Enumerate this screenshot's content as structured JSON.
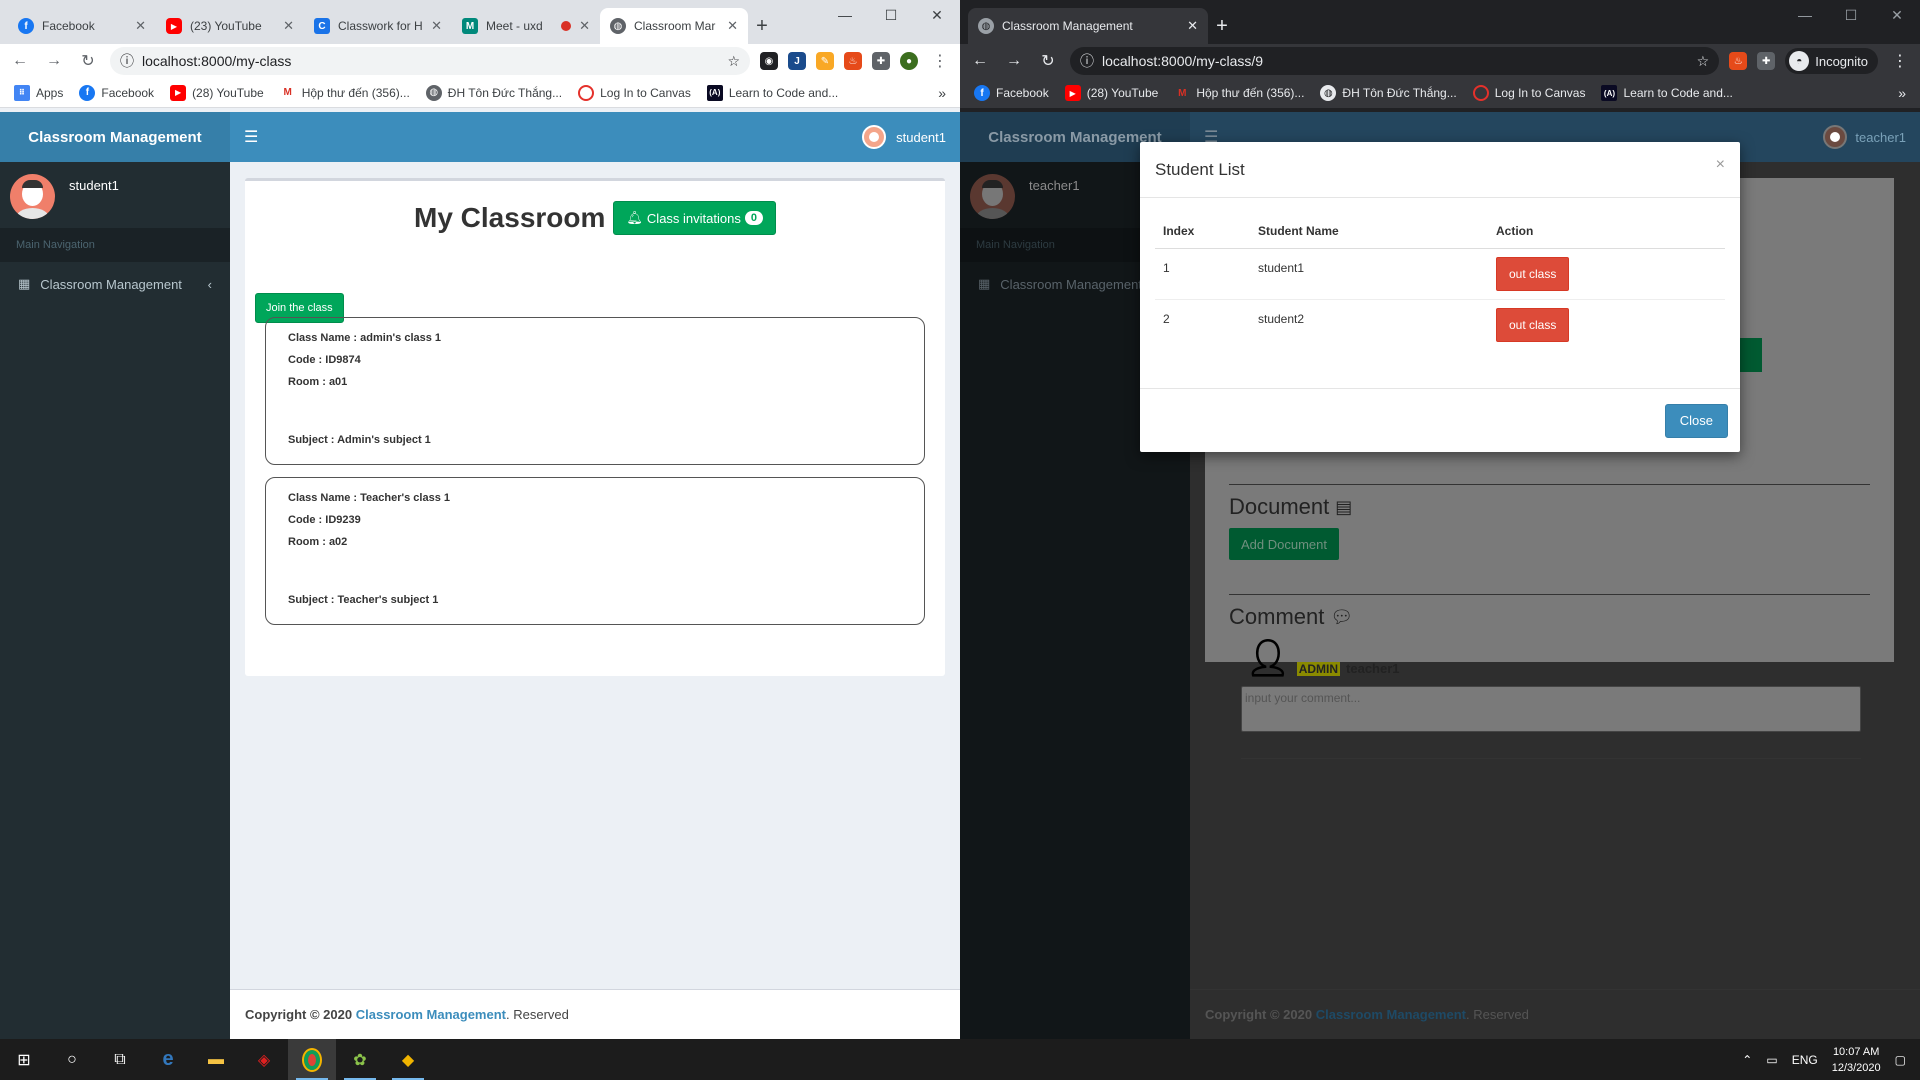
{
  "left_browser": {
    "tabs": [
      {
        "title": "Facebook",
        "icon": "facebook-icon",
        "color": "#1877f2",
        "glyph": "f"
      },
      {
        "title": "(23) YouTube",
        "icon": "youtube-icon",
        "color": "#ff0000",
        "glyph": "▶"
      },
      {
        "title": "Classwork for H",
        "icon": "classroom-icon",
        "color": "#1a73e8",
        "glyph": "C"
      },
      {
        "title": "Meet - uxd",
        "icon": "meet-icon",
        "color": "#00897b",
        "glyph": "M"
      },
      {
        "title": "Classroom Mar",
        "icon": "globe-icon",
        "color": "#5f6368",
        "glyph": "◍",
        "active": true
      }
    ],
    "url": "localhost:8000/my-class",
    "bookmarks": [
      {
        "label": "Apps",
        "icon": "apps-grid-icon"
      },
      {
        "label": "Facebook",
        "icon": "facebook-icon"
      },
      {
        "label": "(28) YouTube",
        "icon": "youtube-icon"
      },
      {
        "label": "Hộp thư đến (356)...",
        "icon": "gmail-icon"
      },
      {
        "label": "ĐH Tôn Đức Thắng...",
        "icon": "university-icon"
      },
      {
        "label": "Log In to Canvas",
        "icon": "canvas-icon"
      },
      {
        "label": "Learn to Code and...",
        "icon": "freecodecamp-icon"
      }
    ]
  },
  "left_app": {
    "brand": "Classroom Management",
    "username": "student1",
    "nav_header": "Main Navigation",
    "nav_item": "Classroom Management",
    "page_title": "My Classroom",
    "invitations_label": "Class invitations",
    "invitations_count": "0",
    "join_label": "Join the class",
    "classes": [
      {
        "name": "Class Name : admin's class 1",
        "code": "Code : ID9874",
        "room": "Room : a01",
        "subject": "Subject : Admin's subject 1"
      },
      {
        "name": "Class Name : Teacher's class 1",
        "code": "Code : ID9239",
        "room": "Room : a02",
        "subject": "Subject : Teacher's subject 1"
      }
    ],
    "footer_prefix": "Copyright © 2020",
    "footer_brand": "Classroom Management",
    "footer_suffix": ". Reserved"
  },
  "right_browser": {
    "tab_title": "Classroom Management",
    "url": "localhost:8000/my-class/9",
    "incognito_label": "Incognito",
    "bookmarks": [
      {
        "label": "Facebook",
        "icon": "facebook-icon"
      },
      {
        "label": "(28) YouTube",
        "icon": "youtube-icon"
      },
      {
        "label": "Hộp thư đến (356)...",
        "icon": "gmail-icon"
      },
      {
        "label": "ĐH Tôn Đức Thắng...",
        "icon": "university-icon"
      },
      {
        "label": "Log In to Canvas",
        "icon": "canvas-icon"
      },
      {
        "label": "Learn to Code and...",
        "icon": "freecodecamp-icon"
      }
    ]
  },
  "right_app": {
    "brand": "Classroom Management",
    "username": "teacher1",
    "nav_header": "Main Navigation",
    "nav_item": "Classroom Management",
    "document_heading": "Document",
    "add_document_label": "Add Document",
    "comment_heading": "Comment",
    "admin_badge": "ADMIN",
    "comment_user": "teacher1",
    "comment_placeholder": "input your comment...",
    "footer_prefix": "Copyright © 2020",
    "footer_brand": "Classroom Management",
    "footer_suffix": ". Reserved"
  },
  "modal": {
    "title": "Student List",
    "columns": [
      "Index",
      "Student Name",
      "Action"
    ],
    "rows": [
      {
        "index": "1",
        "name": "student1",
        "action": "out class"
      },
      {
        "index": "2",
        "name": "student2",
        "action": "out class"
      }
    ],
    "close_label": "Close"
  },
  "taskbar": {
    "lang": "ENG",
    "time": "10:07 AM",
    "date": "12/3/2020"
  }
}
